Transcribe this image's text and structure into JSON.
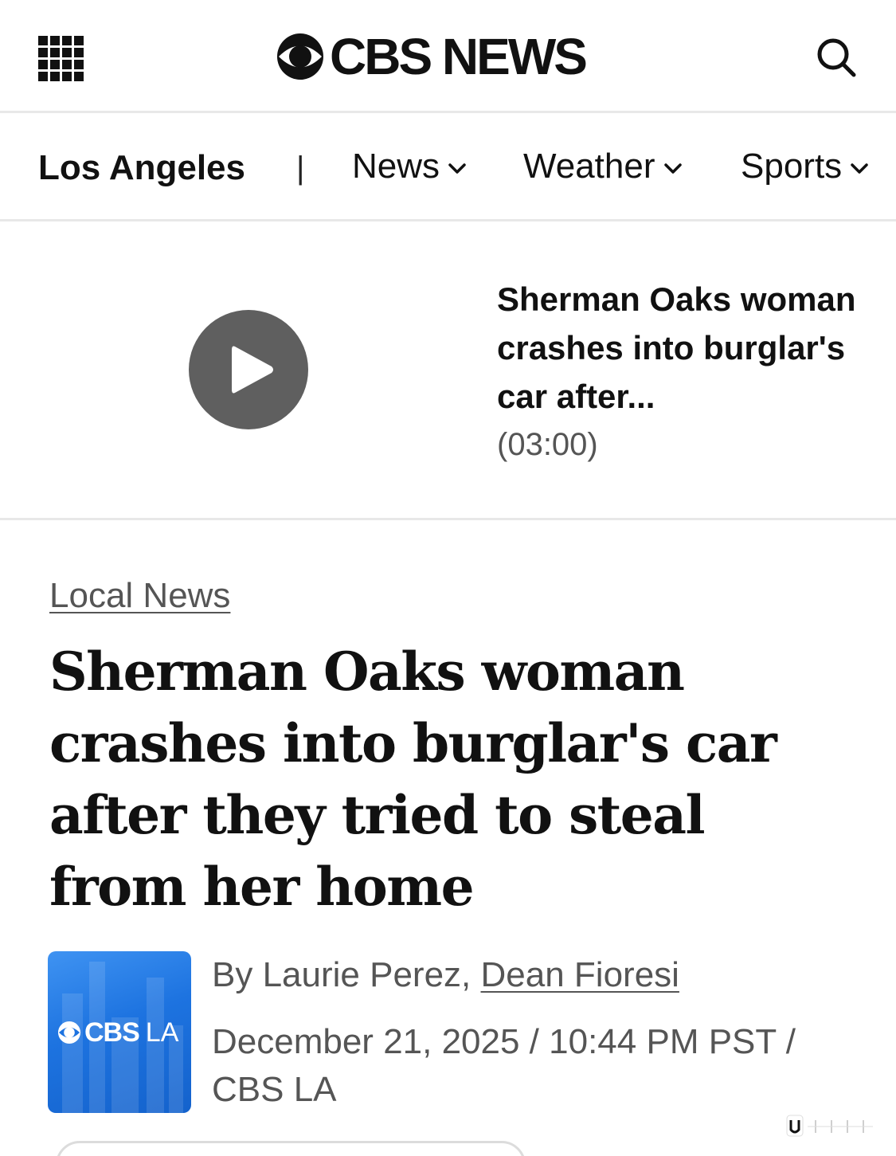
{
  "header": {
    "logo_text": "CBS NEWS"
  },
  "nav": {
    "section": "Los Angeles",
    "separator": "|",
    "items": [
      {
        "label": "News"
      },
      {
        "label": "Weather"
      },
      {
        "label": "Sports"
      }
    ]
  },
  "video": {
    "title": "Sherman Oaks woman crashes into burglar's car after...",
    "duration": "(03:00)"
  },
  "article": {
    "category": "Local News",
    "headline": "Sherman Oaks woman crashes into burglar's car after they tried to steal from her home",
    "byline_prefix": "By Laurie Perez, ",
    "byline_author_link": "Dean Fioresi",
    "dateline": "December 21, 2025 / 10:44 PM PST / CBS LA",
    "station_logo_text": "CBS",
    "station_logo_suffix": "LA"
  }
}
